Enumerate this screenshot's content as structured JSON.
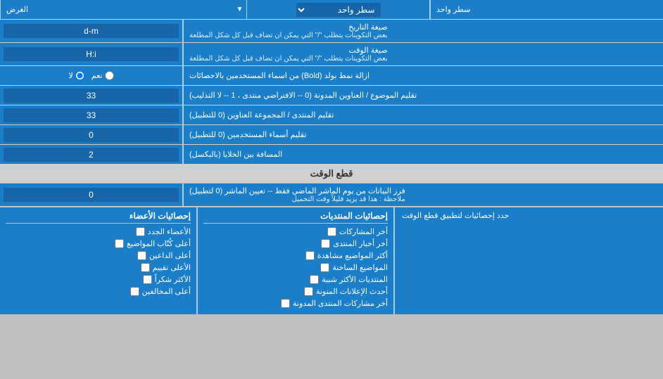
{
  "rows": [
    {
      "label": "الغرض",
      "type": "select",
      "value": "سطر واحد"
    },
    {
      "label": "صيغة التاريخ\nبعض التكوينات يتطلب \"/\" التي يمكن ان تضاف قبل كل شكل المطلعة",
      "type": "text",
      "value": "d-m"
    },
    {
      "label": "صيغة الوقت\nبعض التكوينات يتطلب \"/\" التي يمكن ان تضاف قبل كل شكل المطلعة",
      "type": "text",
      "value": "H:i"
    },
    {
      "label": "ازالة نمط بولد (Bold) من اسماء المستخدمين بالاحصائات",
      "type": "radio",
      "options": [
        "نعم",
        "لا"
      ],
      "selected": 1
    },
    {
      "label": "تقليم الموضوع / العناوين المدونة (0 -- الافتراضي منتدى ، 1 -- لا التذليب)",
      "type": "text",
      "value": "33"
    },
    {
      "label": "تقليم المنتدى / المجموعة العناوين (0 للتطبيل)",
      "type": "text",
      "value": "33"
    },
    {
      "label": "تقليم أسماء المستخدمين (0 للتطبيل)",
      "type": "text",
      "value": "0"
    },
    {
      "label": "المسافة بين الخلايا (بالبكسل)",
      "type": "text",
      "value": "2"
    }
  ],
  "section_header": "قطع الوقت",
  "cut_row": {
    "label": "فرز البيانات من يوم الماشر الماضي فقط -- تعيين الماشر (0 لتطبيل)\nملاحظة : هذا قد يزيد قليلاً وقت التحميل",
    "type": "text",
    "value": "0"
  },
  "stats_label": "حدد إحصائيات لتطبيق قطع الوقت",
  "col1_header": "إحصائيات الأعضاء",
  "col1_items": [
    "الأعضاء الجدد",
    "أعلى كُتّاب المواضيع",
    "أعلى الداعين",
    "الأعلى تقييم",
    "الأكثر شكراً",
    "أعلى المخالفين"
  ],
  "col2_header": "إحصائيات المنتديات",
  "col2_items": [
    "أخر المشاركات",
    "أخر أخبار المنتدى",
    "أكثر المواضيع مشاهدة",
    "المواضيع الساخنة",
    "المنتديات الأكثر شبية",
    "أحدث الإعلانات المنونة",
    "أخر مشاركات المنتدى المدونة"
  ],
  "labels": {
    "one_line": "سطر واحد",
    "date_format": "صيغة التاريخ",
    "date_note": "بعض التكوينات يتطلب \"/\" التي يمكن ان تضاف قبل كل شكل المطلعة",
    "time_format": "صيغة الوقت",
    "time_note": "بعض التكوينات يتطلب \"/\" التي يمكن ان تضاف قبل كل شكل المطلعة",
    "bold_label": "ازالة نمط بولد (Bold) من اسماء المستخدمين بالاحصائات",
    "yes": "نعم",
    "no": "لا",
    "trim1": "تقليم الموضوع / العناوين المدونة (0 -- الافتراضي منتدى ، 1 -- لا التذليب)",
    "trim2": "تقليم المنتدى / المجموعة العناوين (0 للتطبيل)",
    "trim3": "تقليم أسماء المستخدمين (0 للتطبيل)",
    "spacing": "المسافة بين الخلايا (بالبكسل)",
    "section_cut": "قطع الوقت",
    "cut_label": "فرز البيانات من يوم الماشر الماضي فقط -- تعيين الماشر (0 لتطبيل)",
    "cut_note": "ملاحظة : هذا قد يزيد قليلاً وقت التحميل",
    "stats_header": "حدد إحصائيات لتطبيق قطع الوقت"
  }
}
